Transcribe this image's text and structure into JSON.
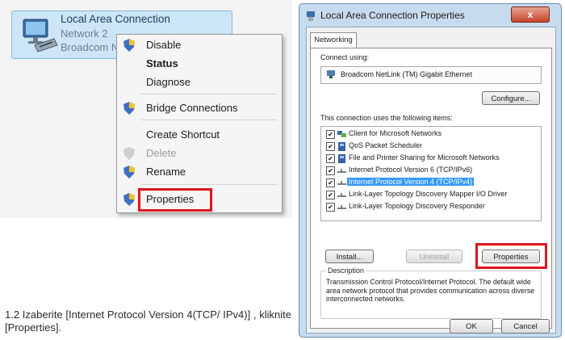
{
  "adapter": {
    "name": "Local Area Connection",
    "network": "Network  2",
    "device": "Broadcom N"
  },
  "context_menu": {
    "items": [
      {
        "label": "Disable",
        "icon": "uac-shield-icon"
      },
      {
        "label": "Status",
        "icon": ""
      },
      {
        "label": "Diagnose",
        "icon": ""
      },
      {
        "label": "Bridge Connections",
        "icon": "uac-shield-icon"
      },
      {
        "label": "Create Shortcut",
        "icon": ""
      },
      {
        "label": "Delete",
        "icon": "uac-shield-icon"
      },
      {
        "label": "Rename",
        "icon": "uac-shield-icon"
      },
      {
        "label": "Properties",
        "icon": "uac-shield-icon"
      }
    ]
  },
  "caption": "1.2 Izaberite [Internet Protocol Version 4(TCP/ IPv4)] , kliknite [Properties].",
  "dialog": {
    "title": "Local Area Connection Properties",
    "close_label": "x",
    "tab": "Networking",
    "connect_using_label": "Connect using:",
    "adapter_name": "Broadcom NetLink (TM) Gigabit Ethernet",
    "configure_button": "Configure...",
    "items_label": "This connection uses the following items:",
    "items": [
      {
        "label": "Client for Microsoft Networks",
        "checked": true
      },
      {
        "label": "QoS Packet Scheduler",
        "checked": true
      },
      {
        "label": "File and Printer Sharing for Microsoft Networks",
        "checked": true
      },
      {
        "label": "Internet Protocol Version 6 (TCP/IPv6)",
        "checked": true
      },
      {
        "label": "Internet Protocol Version 4 (TCP/IPv4)",
        "checked": true,
        "selected": true
      },
      {
        "label": "Link-Layer Topology Discovery Mapper I/O Driver",
        "checked": true
      },
      {
        "label": "Link-Layer Topology Discovery Responder",
        "checked": true
      }
    ],
    "install_button": "Install...",
    "uninstall_button": "Uninstall",
    "properties_button": "Properties",
    "description_label": "Description",
    "description_text": "Transmission Control Protocol/Internet Protocol. The default wide area network protocol that provides communication across diverse interconnected networks.",
    "ok_button": "OK",
    "cancel_button": "Cancel"
  },
  "colors": {
    "highlight": "#e0141c",
    "selection": "#3399ff"
  }
}
